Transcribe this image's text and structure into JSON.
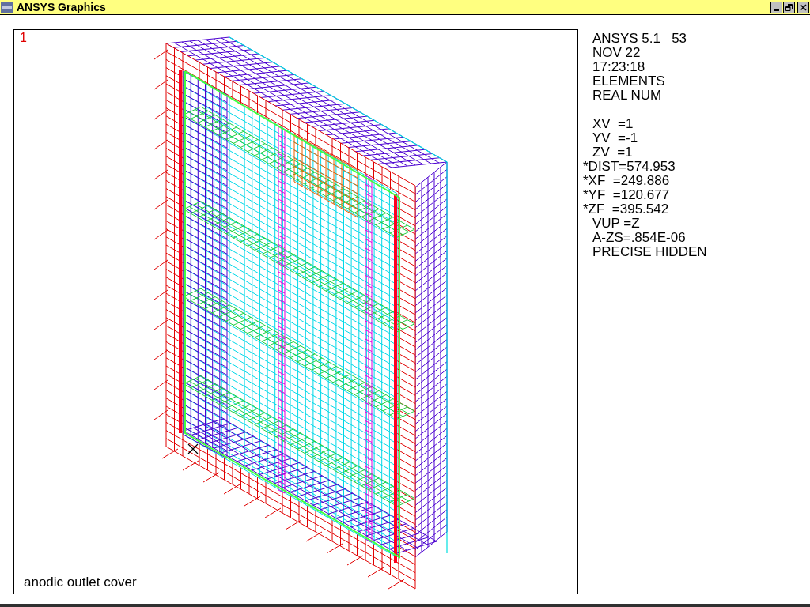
{
  "window": {
    "title": "ANSYS Graphics"
  },
  "viewport": {
    "number": "1",
    "caption": "anodic outlet cover"
  },
  "info_header": [
    {
      "text": "ANSYS 5.1   53",
      "kind": "plain"
    },
    {
      "text": "NOV 22",
      "kind": "plain"
    },
    {
      "text": "17:23:18",
      "kind": "plain"
    },
    {
      "text": "ELEMENTS",
      "kind": "plain"
    },
    {
      "text": "REAL NUM",
      "kind": "plain"
    }
  ],
  "view_settings": [
    {
      "text": "XV  =1",
      "kind": "plain"
    },
    {
      "text": "YV  =-1",
      "kind": "plain"
    },
    {
      "text": "ZV  =1",
      "kind": "plain"
    },
    {
      "text": "*DIST=574.953",
      "kind": "starred"
    },
    {
      "text": "*XF  =249.886",
      "kind": "starred"
    },
    {
      "text": "*YF  =120.677",
      "kind": "starred"
    },
    {
      "text": "*ZF  =395.542",
      "kind": "starred"
    },
    {
      "text": "VUP =Z",
      "kind": "plain"
    },
    {
      "text": "A-ZS=.854E-06",
      "kind": "plain"
    },
    {
      "text": "PRECISE HIDDEN",
      "kind": "plain"
    }
  ]
}
